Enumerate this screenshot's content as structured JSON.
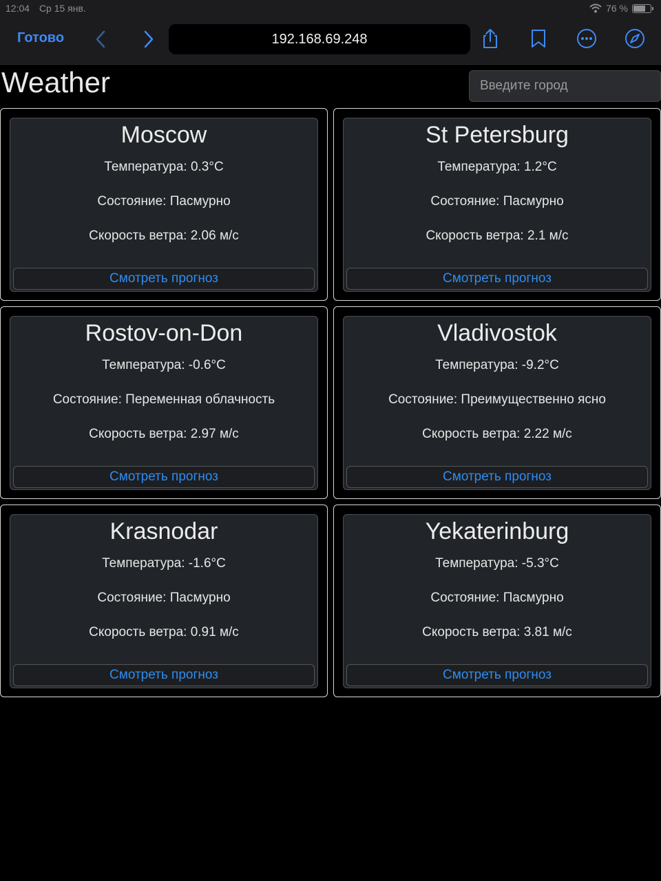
{
  "status_bar": {
    "time": "12:04",
    "date": "Ср 15 янв.",
    "battery_text": "76 %",
    "battery_level": 0.76
  },
  "browser": {
    "done_label": "Готово",
    "url": "192.168.69.248"
  },
  "page": {
    "title": "Weather",
    "search_placeholder": "Введите город",
    "forecast_label": "Смотреть прогноз",
    "cards": [
      {
        "city": "Moscow",
        "temperature": "Температура: 0.3°C",
        "condition": "Состояние: Пасмурно",
        "wind": "Скорость ветра: 2.06 м/с"
      },
      {
        "city": "St Petersburg",
        "temperature": "Температура: 1.2°C",
        "condition": "Состояние: Пасмурно",
        "wind": "Скорость ветра: 2.1 м/с"
      },
      {
        "city": "Rostov-on-Don",
        "temperature": "Температура: -0.6°C",
        "condition": "Состояние: Переменная облачность",
        "wind": "Скорость ветра: 2.97 м/с"
      },
      {
        "city": "Vladivostok",
        "temperature": "Температура: -9.2°C",
        "condition": "Состояние: Преимущественно ясно",
        "wind": "Скорость ветра: 2.22 м/с"
      },
      {
        "city": "Krasnodar",
        "temperature": "Температура: -1.6°C",
        "condition": "Состояние: Пасмурно",
        "wind": "Скорость ветра: 0.91 м/с"
      },
      {
        "city": "Yekaterinburg",
        "temperature": "Температура: -5.3°C",
        "condition": "Состояние: Пасмурно",
        "wind": "Скорость ветра: 3.81 м/с"
      }
    ]
  },
  "icons": {
    "back": "chevron-left-icon",
    "forward": "chevron-right-icon",
    "share": "share-icon",
    "bookmarks": "bookmark-icon",
    "more": "ellipsis-icon",
    "compass": "compass-icon",
    "wifi": "wifi-icon",
    "battery": "battery-icon"
  },
  "colors": {
    "accent": "#3d8af7",
    "link": "#2f8cf0",
    "card_bg": "#212529",
    "page_bg": "#000000"
  }
}
